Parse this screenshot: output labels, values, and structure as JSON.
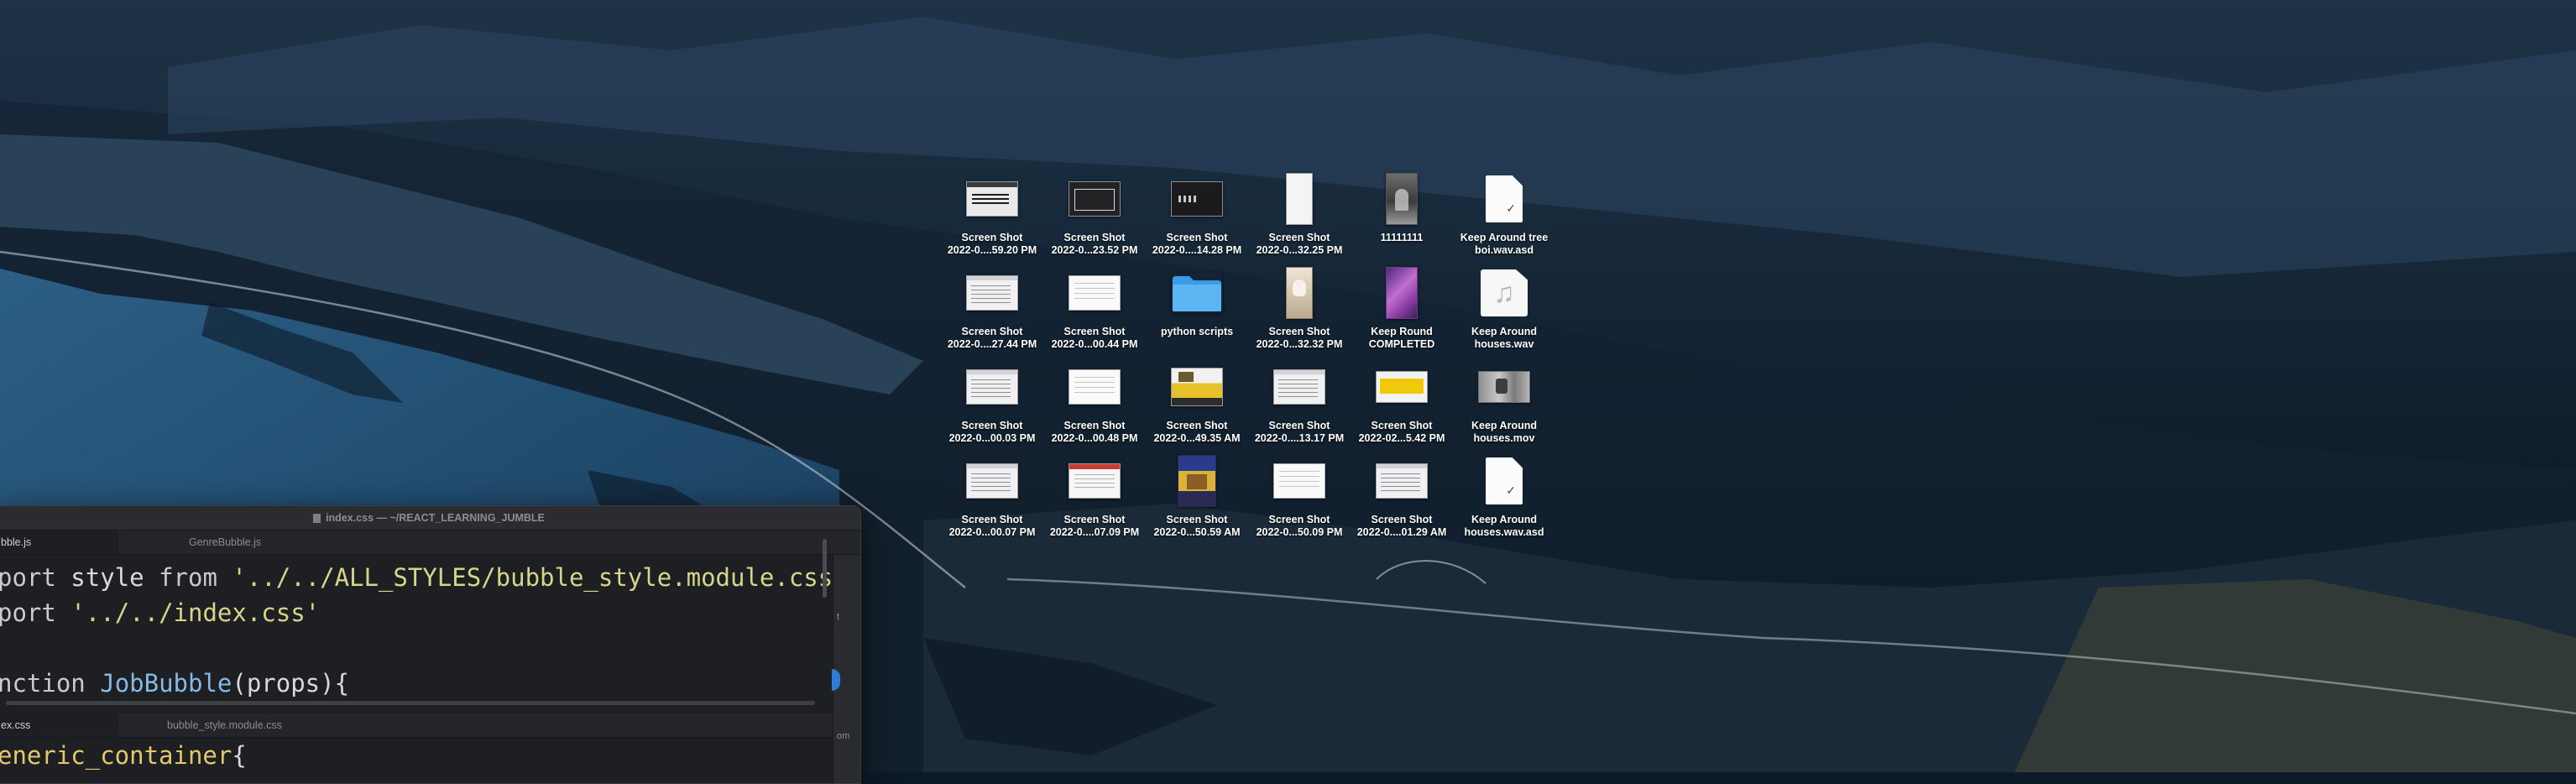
{
  "desktop": {
    "items": [
      {
        "thumb": "t-window",
        "line1": "Screen Shot",
        "line2": "2022-0....59.20 PM"
      },
      {
        "thumb": "t-dark",
        "line1": "Screen Shot",
        "line2": "2022-0...23.52 PM"
      },
      {
        "thumb": "t-dark2",
        "line1": "Screen Shot",
        "line2": "2022-0....14.28 PM"
      },
      {
        "thumb": "t-tall",
        "line1": "Screen Shot",
        "line2": "2022-0...32.25 PM"
      },
      {
        "thumb": "t-photo-grey",
        "line1": "11111111",
        "line2": ""
      },
      {
        "thumb": "t-doc",
        "line1": "Keep Around tree",
        "line2": "boi.wav.asd"
      },
      {
        "thumb": "t-light",
        "line1": "Screen Shot",
        "line2": "2022-0....27.44 PM"
      },
      {
        "thumb": "t-light2",
        "line1": "Screen Shot",
        "line2": "2022-0...00.44 PM"
      },
      {
        "thumb": "t-folder",
        "line1": "python scripts",
        "line2": ""
      },
      {
        "thumb": "t-skull",
        "line1": "Screen Shot",
        "line2": "2022-0...32.32 PM"
      },
      {
        "thumb": "t-purple",
        "line1": "Keep Round",
        "line2": "COMPLETED"
      },
      {
        "thumb": "t-music",
        "line1": "Keep Around",
        "line2": "houses.wav"
      },
      {
        "thumb": "t-light",
        "line1": "Screen Shot",
        "line2": "2022-0...00.03 PM"
      },
      {
        "thumb": "t-light2",
        "line1": "Screen Shot",
        "line2": "2022-0...00.48 PM"
      },
      {
        "thumb": "t-yellowpic",
        "line1": "Screen Shot",
        "line2": "2022-0...49.35 AM"
      },
      {
        "thumb": "t-light",
        "line1": "Screen Shot",
        "line2": "2022-0....13.17 PM"
      },
      {
        "thumb": "t-yellowticket",
        "line1": "Screen Shot",
        "line2": "2022-02...5.42 PM"
      },
      {
        "thumb": "t-movie",
        "line1": "Keep Around",
        "line2": "houses.mov"
      },
      {
        "thumb": "t-light",
        "line1": "Screen Shot",
        "line2": "2022-0...00.07 PM"
      },
      {
        "thumb": "t-redstripe",
        "line1": "Screen Shot",
        "line2": "2022-0....07.09 PM"
      },
      {
        "thumb": "t-poster",
        "line1": "Screen Shot",
        "line2": "2022-0...50.59 AM"
      },
      {
        "thumb": "t-light2",
        "line1": "Screen Shot",
        "line2": "2022-0...50.09 PM"
      },
      {
        "thumb": "t-light",
        "line1": "Screen Shot",
        "line2": "2022-0....01.29 AM"
      },
      {
        "thumb": "t-doc",
        "line1": "Keep Around",
        "line2": "houses.wav.asd"
      }
    ]
  },
  "editor": {
    "title": "index.css — ~/REACT_LEARNING_JUMBLE",
    "top_tabs": [
      "bble.js",
      "GenreBubble.js"
    ],
    "bottom_tabs": [
      "ex.css",
      "bubble_style.module.css"
    ],
    "side_strip_text": [
      "t",
      "om"
    ],
    "code_top": {
      "l1_kw": "port",
      "l1_mid": " style ",
      "l1_from": "from",
      "l1_str": "'../../ALL_STYLES/bubble_style.module.css'",
      "l2_kw": "port",
      "l2_str": "'../../index.css'",
      "l4_kw": "nction",
      "l4_fn": "JobBubble",
      "l4_rest": "(props){",
      "l5": "  ..."
    },
    "code_bottom": {
      "l1_cls": "eneric_container",
      "l1_rest": "{"
    }
  }
}
